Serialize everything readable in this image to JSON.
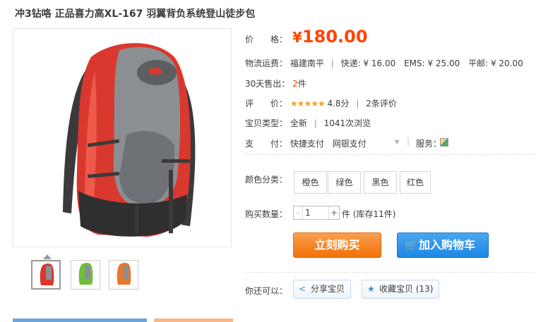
{
  "product": {
    "title": "冲3钻咯 正品喜力高XL-167 羽翼背负系统登山徒步包"
  },
  "price": {
    "label": "价　　格：",
    "symbol": "¥",
    "value": "180.00"
  },
  "shipping": {
    "label": "物流运费：",
    "origin": "福建南平",
    "express_label": "快递: ¥ 16.00",
    "ems_label": "EMS: ¥ 25.00",
    "mail_label": "平邮: ¥ 20.00"
  },
  "sales": {
    "label": "30天售出：",
    "count": "2",
    "unit": "件"
  },
  "rating": {
    "label": "评　　价：",
    "stars": "★★★★★",
    "score": "4.8分",
    "reviews": "2条评价"
  },
  "type": {
    "label": "宝贝类型：",
    "condition": "全新",
    "views": "1041次浏览"
  },
  "payment": {
    "label": "支　　付：",
    "methods": [
      "快捷支付",
      "网银支付"
    ],
    "service_label": "服务："
  },
  "color": {
    "label": "颜色分类：",
    "options": [
      "橙色",
      "绿色",
      "黑色",
      "红色"
    ]
  },
  "quantity": {
    "label": "购买数量：",
    "value": "1",
    "minus": "-",
    "plus": "+",
    "stock": "件 (库存11件)"
  },
  "actions": {
    "buy": "立刻购买",
    "cart": "加入购物车"
  },
  "social": {
    "label": "你还可以：",
    "share": "分享宝贝",
    "favorite": "收藏宝贝 (13)"
  },
  "colors": {
    "accent": "#ff4400",
    "buy_button": "#f27108",
    "cart_button": "#1b87e4",
    "stars": "#f9a01c"
  },
  "icons": {
    "cart": "shopping-cart-icon",
    "share": "share-icon",
    "favorite": "star-icon",
    "service": "service-icon"
  }
}
